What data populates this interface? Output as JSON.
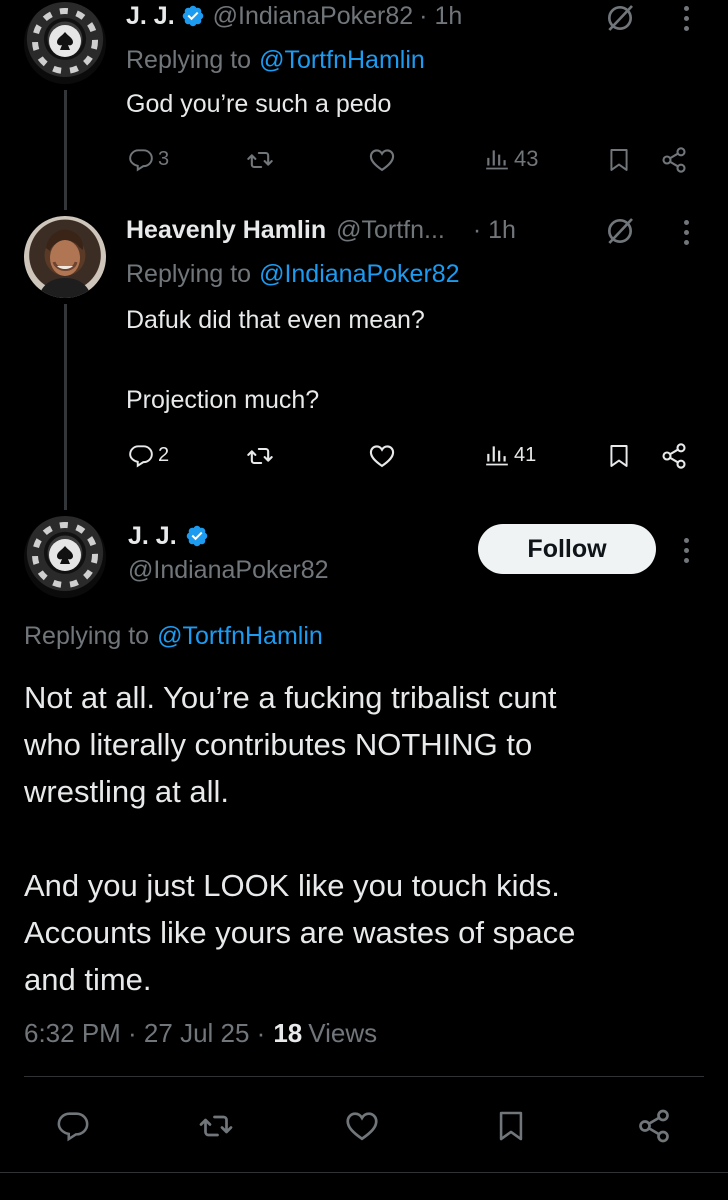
{
  "tweet1": {
    "display_name": "J. J.",
    "handle": "@IndianaPoker82",
    "time": "· 1h",
    "replying_prefix": "Replying to",
    "replying_to": "@TortfnHamlin",
    "text": "God you’re such a pedo",
    "replies": "3",
    "views": "43",
    "avatar_icon": "poker-chip-avatar"
  },
  "tweet2": {
    "display_name": "Heavenly Hamlin",
    "handle": "@Tortfn...",
    "time": "· 1h",
    "replying_prefix": "Replying to",
    "replying_to": "@IndianaPoker82",
    "text_line1": "Dafuk did that even mean?",
    "text_line2": "Projection much?",
    "replies": "2",
    "views": "41",
    "avatar_icon": "person-photo-avatar"
  },
  "main_tweet": {
    "display_name": "J. J.",
    "handle": "@IndianaPoker82",
    "follow_label": "Follow",
    "replying_prefix": "Replying to",
    "replying_to": "@TortfnHamlin",
    "paragraph1_line1": "Not at all. You’re a fucking tribalist cunt",
    "paragraph1_line2": "who literally contributes NOTHING to",
    "paragraph1_line3": "wrestling at all.",
    "paragraph2_line1": "And you just LOOK like you touch kids.",
    "paragraph2_line2": "Accounts like yours are wastes of space",
    "paragraph2_line3": "and time.",
    "timestamp": "6:32 PM · 27 Jul 25 ·",
    "views_count": "18",
    "views_label": "Views"
  },
  "colors": {
    "background": "#000000",
    "text": "#e7e9ea",
    "muted": "#71767b",
    "link": "#1d9bf0",
    "verified": "#1d9bf0",
    "divider": "#2f3336"
  }
}
